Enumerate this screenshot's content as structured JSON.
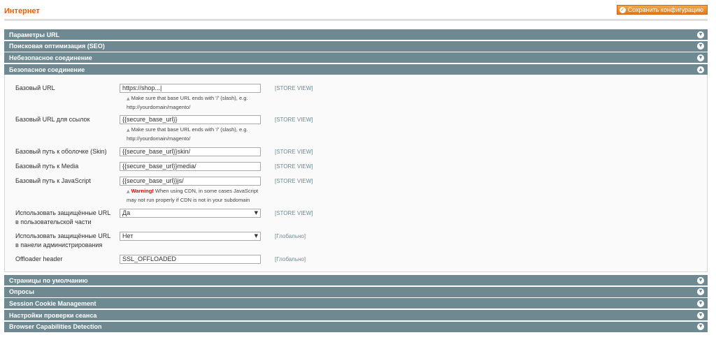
{
  "header": {
    "title": "Интернет",
    "save_label": "Сохранить конфигурацию"
  },
  "sections_top": [
    {
      "label": "Параметры URL"
    },
    {
      "label": "Поисковая оптимизация (SEO)"
    },
    {
      "label": "Небезопасное соединение"
    }
  ],
  "open_section": {
    "label": "Безопасное соединение",
    "fields": [
      {
        "label": "Базовый URL",
        "value": "https://shop...|",
        "scope": "[STORE VIEW]",
        "note_line1": "Make sure that base URL ends with '/' (slash), e.g.",
        "note_line2": "http://yourdomain/magento/"
      },
      {
        "label": "Базовый URL для ссылок",
        "value": "{{secure_base_url}}",
        "scope": "[STORE VIEW]",
        "note_line1": "Make sure that base URL ends with '/' (slash), e.g.",
        "note_line2": "http://yourdomain/magento/"
      },
      {
        "label": "Базовый путь к оболочке (Skin)",
        "value": "{{secure_base_url}}skin/",
        "scope": "[STORE VIEW]"
      },
      {
        "label": "Базовый путь к Media",
        "value": "{{secure_base_url}}media/",
        "scope": "[STORE VIEW]"
      },
      {
        "label": "Базовый путь к JavaScript",
        "value": "{{secure_base_url}}js/",
        "scope": "[STORE VIEW]",
        "warning_label": "Warning!",
        "note_line1": " When using CDN, in some cases JavaScript",
        "note_line2": "may not run properly if CDN is not in your subdomain"
      },
      {
        "label_line1": "Использовать защищённые URL",
        "label_line2": "в пользовательской части",
        "value": "Да",
        "scope": "[STORE VIEW]"
      },
      {
        "label_line1": "Использовать защищённые URL",
        "label_line2": "в панели администрирования",
        "value": "Нет",
        "scope": "[Глобально]"
      },
      {
        "label": "Offloader header",
        "value": "SSL_OFFLOADED",
        "scope": "[Глобально]"
      }
    ]
  },
  "sections_bottom": [
    {
      "label": "Страницы по умолчанию"
    },
    {
      "label": "Опросы"
    },
    {
      "label": "Session Cookie Management"
    },
    {
      "label": "Настройки проверки сеанса"
    },
    {
      "label": "Browser Capabilities Detection"
    }
  ],
  "icons": {
    "collapsed": "chevron-down-icon",
    "expanded": "chevron-up-icon",
    "save": "check-icon",
    "note": "triangle-icon"
  },
  "colors": {
    "accent": "#eb5e00",
    "section_header": "#6f8992",
    "button": "#e47a10",
    "warning": "#d40707"
  }
}
